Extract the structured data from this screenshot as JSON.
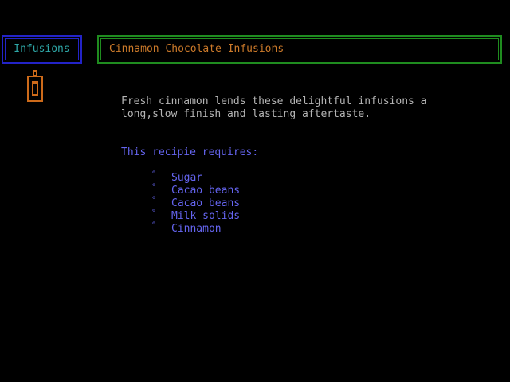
{
  "header": {
    "category": "Infusions",
    "title": "Cinnamon Chocolate Infusions"
  },
  "icons": {
    "bottle": "bottle-icon"
  },
  "content": {
    "description": "Fresh cinnamon lends these delightful infusions a\nlong,slow finish and lasting aftertaste.",
    "requires_heading": "This recipie requires:",
    "bullet": "°",
    "ingredients": [
      "Sugar",
      "Cacao beans",
      "Cacao beans",
      "Milk solids",
      "Cinnamon"
    ]
  },
  "colors": {
    "background": "#000000",
    "category_border": "#2323c8",
    "category_text": "#2ea8a8",
    "title_border": "#1f8c1f",
    "title_text": "#cc7a2a",
    "icon": "#cc6a1a",
    "body_text": "#b4b4b4",
    "list_text": "#6565f0"
  }
}
